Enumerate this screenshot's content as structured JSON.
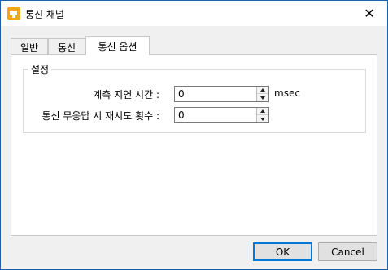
{
  "window": {
    "title": "통신 채널",
    "icon": "app-icon",
    "close_symbol": "✕"
  },
  "tabs": [
    {
      "label": "일반",
      "active": false
    },
    {
      "label": "통신",
      "active": false
    },
    {
      "label": "통신 옵션",
      "active": true
    }
  ],
  "group": {
    "title": "설정",
    "fields": [
      {
        "label": "계측 지연 시간 :",
        "value": "0",
        "unit": "msec"
      },
      {
        "label": "통신 무응답 시 재시도 횟수 :",
        "value": "0",
        "unit": ""
      }
    ]
  },
  "buttons": {
    "ok": "OK",
    "cancel": "Cancel"
  },
  "colors": {
    "accent": "#0078d7",
    "icon": "#f2a516"
  }
}
